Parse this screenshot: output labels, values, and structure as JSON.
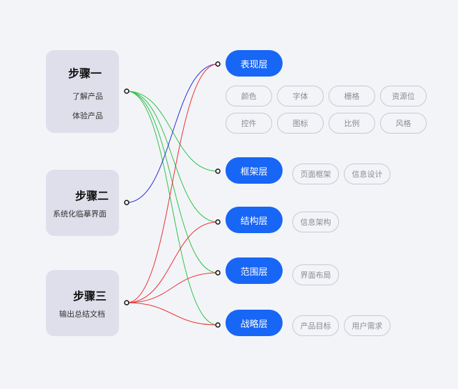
{
  "steps": [
    {
      "title": "步骤一",
      "items": [
        "了解产品",
        "体验产品"
      ]
    },
    {
      "title": "步骤二",
      "items": [
        "系统化临摹界面"
      ]
    },
    {
      "title": "步骤三",
      "items": [
        "输出总结文档"
      ]
    }
  ],
  "layers": [
    {
      "label": "表现层",
      "tags": [
        "颜色",
        "字体",
        "栅格",
        "资源位",
        "控件",
        "图标",
        "比例",
        "风格"
      ]
    },
    {
      "label": "框架层",
      "tags": [
        "页面框架",
        "信息设计"
      ]
    },
    {
      "label": "结构层",
      "tags": [
        "信息架构"
      ]
    },
    {
      "label": "范围层",
      "tags": [
        "界面布局"
      ]
    },
    {
      "label": "战略层",
      "tags": [
        "产品目标",
        "用户需求"
      ]
    }
  ],
  "connections": [
    {
      "from": 0,
      "to": 1,
      "color": "#2ec24a"
    },
    {
      "from": 0,
      "to": 2,
      "color": "#2ec24a"
    },
    {
      "from": 0,
      "to": 3,
      "color": "#2ec24a"
    },
    {
      "from": 0,
      "to": 4,
      "color": "#2ec24a"
    },
    {
      "from": 1,
      "to": 0,
      "color": "#2b2bd0"
    },
    {
      "from": 2,
      "to": 0,
      "color": "#e83030"
    },
    {
      "from": 2,
      "to": 2,
      "color": "#e83030"
    },
    {
      "from": 2,
      "to": 3,
      "color": "#e83030"
    },
    {
      "from": 2,
      "to": 4,
      "color": "#e83030"
    }
  ],
  "colors": {
    "layer_fill": "#1766f5",
    "step_fill": "#dedfea",
    "background": "#f3f4f8"
  }
}
